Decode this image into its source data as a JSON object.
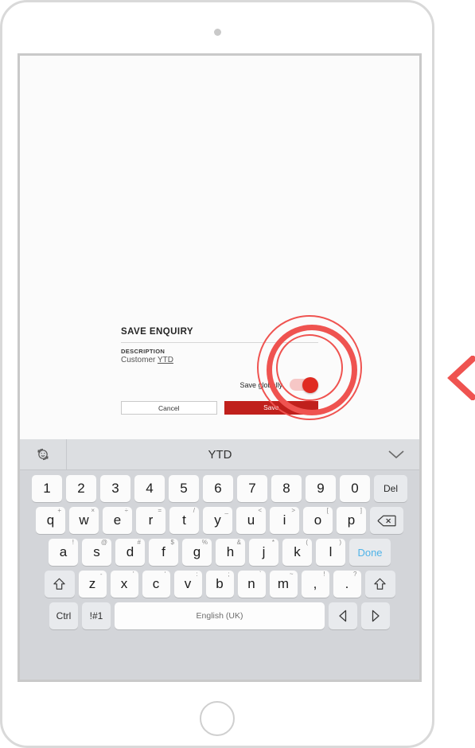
{
  "device": {
    "camera_icon": "camera-dot",
    "home_button_icon": "home-circle"
  },
  "dialog": {
    "title": "SAVE ENQUIRY",
    "field_label": "DESCRIPTION",
    "field_value_prefix": "Customer ",
    "field_value_misspelled": "YTD",
    "toggle_label": "Save globally",
    "toggle_state": "on",
    "cancel_label": "Cancel",
    "save_label": "Save"
  },
  "annotation": {
    "ripple_color": "#ef5350",
    "pointer_icon": "chevron-left-icon",
    "pointer_color": "#ef5350"
  },
  "keyboard": {
    "suggestion_bar": {
      "emoji_icon": "emoji-rotate-icon",
      "suggestion": "YTD",
      "collapse_icon": "chevron-down-icon"
    },
    "row_numbers": [
      {
        "main": "1",
        "sup": ""
      },
      {
        "main": "2",
        "sup": ""
      },
      {
        "main": "3",
        "sup": ""
      },
      {
        "main": "4",
        "sup": ""
      },
      {
        "main": "5",
        "sup": ""
      },
      {
        "main": "6",
        "sup": ""
      },
      {
        "main": "7",
        "sup": ""
      },
      {
        "main": "8",
        "sup": ""
      },
      {
        "main": "9",
        "sup": ""
      },
      {
        "main": "0",
        "sup": ""
      }
    ],
    "del_label": "Del",
    "row_q": [
      {
        "main": "q",
        "sup": "+"
      },
      {
        "main": "w",
        "sup": "×"
      },
      {
        "main": "e",
        "sup": "÷"
      },
      {
        "main": "r",
        "sup": "="
      },
      {
        "main": "t",
        "sup": "/"
      },
      {
        "main": "y",
        "sup": "_"
      },
      {
        "main": "u",
        "sup": "<"
      },
      {
        "main": "i",
        "sup": ">"
      },
      {
        "main": "o",
        "sup": "["
      },
      {
        "main": "p",
        "sup": "]"
      }
    ],
    "backspace_icon": "backspace-icon",
    "row_a": [
      {
        "main": "a",
        "sup": "!"
      },
      {
        "main": "s",
        "sup": "@"
      },
      {
        "main": "d",
        "sup": "#"
      },
      {
        "main": "f",
        "sup": "$"
      },
      {
        "main": "g",
        "sup": "%"
      },
      {
        "main": "h",
        "sup": "&"
      },
      {
        "main": "j",
        "sup": "*"
      },
      {
        "main": "k",
        "sup": "("
      },
      {
        "main": "l",
        "sup": ")"
      }
    ],
    "done_label": "Done",
    "row_z": [
      {
        "main": "z",
        "sup": "-"
      },
      {
        "main": "x",
        "sup": "'"
      },
      {
        "main": "c",
        "sup": "‘"
      },
      {
        "main": "v",
        "sup": ":"
      },
      {
        "main": "b",
        "sup": ";"
      },
      {
        "main": "n",
        "sup": "`"
      },
      {
        "main": "m",
        "sup": "~"
      },
      {
        "main": ",",
        "sup": "!"
      },
      {
        "main": ".",
        "sup": "?"
      }
    ],
    "shift_icon": "shift-icon",
    "ctrl_label": "Ctrl",
    "symbols_label": "!#1",
    "space_label": "English (UK)",
    "arrow_left_icon": "caret-left-icon",
    "arrow_right_icon": "caret-right-icon"
  }
}
